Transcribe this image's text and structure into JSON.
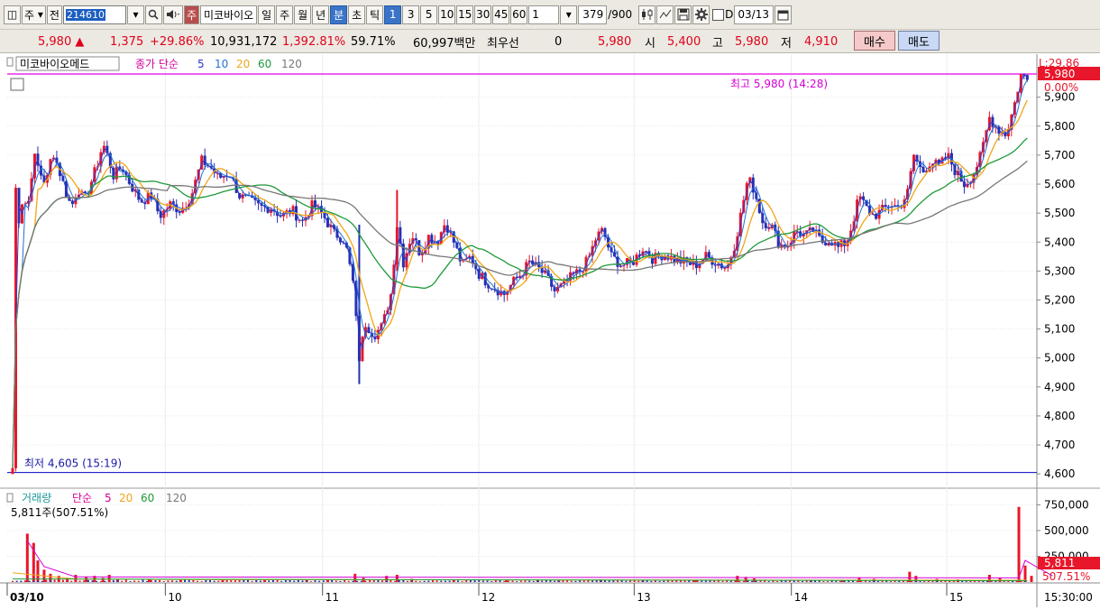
{
  "toolbar": {
    "grid_glyph": "◫",
    "period_label": "주",
    "prev_label": "전",
    "stock_code": "214610",
    "stock_type": "주",
    "stock_name": "미코바이오",
    "period_tabs": [
      "일",
      "주",
      "월",
      "년",
      "분",
      "초",
      "틱"
    ],
    "interval_tabs": [
      "1",
      "3",
      "5",
      "10",
      "15",
      "30",
      "45",
      "60"
    ],
    "interval_value": "1",
    "count_value": "379",
    "count_total": "/900",
    "checkbox_label": "D",
    "date_value": "03/13",
    "icons": [
      "search-icon",
      "speaker-icon",
      "candle-icon",
      "line-icon",
      "save-icon",
      "gear-icon",
      "calendar-icon"
    ]
  },
  "quote": {
    "price": "5,980",
    "arrow": "▲",
    "change": "1,375",
    "change_pct": "+29.86%",
    "volume": "10,931,172",
    "volume_pct": "1,392.81%",
    "rate": "59.71%",
    "amount": "60,997백만",
    "priority_label": "최우선",
    "priority_value": "0",
    "priority_price": "5,980",
    "open_label": "시",
    "open": "5,400",
    "high_label": "고",
    "high": "5,980",
    "low_label": "저",
    "low": "4,910",
    "buy_label": "매수",
    "sell_label": "매도"
  },
  "price_panel": {
    "stock_label": "미코바이오메드",
    "ma_label": "종가 단순",
    "ma_periods": [
      "5",
      "10",
      "20",
      "60",
      "120"
    ],
    "ma_colors": [
      "#3036c8",
      "#1e72d2",
      "#f0a616",
      "#1f9a3a",
      "#777777"
    ],
    "high_note": "최고 5,980 (14:28)",
    "low_note": "최저 4,605 (15:19)",
    "right_top_label": "L:29.86",
    "price_tag": "5,980",
    "pct_tag": "0.00%"
  },
  "volume_panel": {
    "label": "거래량",
    "ma_label": "단순",
    "ma_periods": [
      "5",
      "20",
      "60",
      "120"
    ],
    "current": "5,811주(507.51%)",
    "tag_value": "5,811",
    "tag_pct": "507.51%"
  },
  "x_axis": {
    "labels": [
      "03/10",
      "10",
      "11",
      "12",
      "13",
      "14",
      "15"
    ],
    "time_label": "15:30:00"
  },
  "chart_data": {
    "type": "candlestick",
    "y_ticks": [
      5900,
      5800,
      5700,
      5600,
      5500,
      5400,
      5300,
      5200,
      5100,
      5000,
      4900,
      4800,
      4700,
      4600
    ],
    "y_tick_labels": [
      "5,900",
      "5,800",
      "5,700",
      "5,600",
      "5,500",
      "5,400",
      "5,300",
      "5,200",
      "5,100",
      "5,000",
      "4,900",
      "4,800",
      "4,700",
      "4,600"
    ],
    "ylim": [
      4560,
      5980
    ],
    "high_line": 5980,
    "low_line": 4605,
    "volume_ticks": [
      750000,
      500000,
      250000
    ],
    "volume_tick_labels": [
      "750,000",
      "500,000",
      "250,000"
    ],
    "volume_ylim": [
      0,
      850000
    ],
    "close_path": [
      [
        0,
        4620
      ],
      [
        2,
        5620
      ],
      [
        6,
        5480
      ],
      [
        10,
        5560
      ],
      [
        14,
        5510
      ],
      [
        20,
        5700
      ],
      [
        26,
        5640
      ],
      [
        32,
        5600
      ],
      [
        38,
        5720
      ],
      [
        44,
        5650
      ],
      [
        50,
        5580
      ],
      [
        56,
        5520
      ],
      [
        62,
        5590
      ],
      [
        68,
        5540
      ],
      [
        74,
        5600
      ],
      [
        80,
        5660
      ],
      [
        86,
        5740
      ],
      [
        90,
        5700
      ],
      [
        96,
        5630
      ],
      [
        104,
        5660
      ],
      [
        112,
        5600
      ],
      [
        122,
        5540
      ],
      [
        132,
        5560
      ],
      [
        140,
        5490
      ],
      [
        150,
        5530
      ],
      [
        160,
        5510
      ],
      [
        170,
        5560
      ],
      [
        180,
        5680
      ],
      [
        188,
        5660
      ],
      [
        196,
        5620
      ],
      [
        206,
        5640
      ],
      [
        216,
        5560
      ],
      [
        226,
        5540
      ],
      [
        236,
        5520
      ],
      [
        246,
        5520
      ],
      [
        256,
        5490
      ],
      [
        266,
        5510
      ],
      [
        276,
        5470
      ],
      [
        286,
        5530
      ],
      [
        296,
        5490
      ],
      [
        306,
        5430
      ],
      [
        316,
        5410
      ],
      [
        324,
        5260
      ],
      [
        330,
        5000
      ],
      [
        336,
        5120
      ],
      [
        344,
        5080
      ],
      [
        352,
        5110
      ],
      [
        360,
        5220
      ],
      [
        366,
        5460
      ],
      [
        372,
        5330
      ],
      [
        380,
        5430
      ],
      [
        388,
        5360
      ],
      [
        396,
        5420
      ],
      [
        404,
        5400
      ],
      [
        412,
        5470
      ],
      [
        420,
        5400
      ],
      [
        428,
        5320
      ],
      [
        436,
        5350
      ],
      [
        444,
        5290
      ],
      [
        452,
        5260
      ],
      [
        460,
        5240
      ],
      [
        468,
        5220
      ],
      [
        476,
        5260
      ],
      [
        484,
        5290
      ],
      [
        492,
        5330
      ],
      [
        500,
        5310
      ],
      [
        508,
        5280
      ],
      [
        516,
        5230
      ],
      [
        524,
        5250
      ],
      [
        532,
        5280
      ],
      [
        540,
        5300
      ],
      [
        548,
        5340
      ],
      [
        556,
        5420
      ],
      [
        562,
        5440
      ],
      [
        570,
        5350
      ],
      [
        580,
        5320
      ],
      [
        590,
        5330
      ],
      [
        600,
        5380
      ],
      [
        610,
        5340
      ],
      [
        620,
        5360
      ],
      [
        630,
        5340
      ],
      [
        640,
        5330
      ],
      [
        650,
        5320
      ],
      [
        660,
        5350
      ],
      [
        670,
        5330
      ],
      [
        680,
        5310
      ],
      [
        688,
        5400
      ],
      [
        694,
        5510
      ],
      [
        700,
        5620
      ],
      [
        706,
        5580
      ],
      [
        714,
        5470
      ],
      [
        722,
        5460
      ],
      [
        730,
        5390
      ],
      [
        738,
        5390
      ],
      [
        746,
        5440
      ],
      [
        754,
        5420
      ],
      [
        762,
        5440
      ],
      [
        770,
        5400
      ],
      [
        778,
        5410
      ],
      [
        786,
        5380
      ],
      [
        794,
        5400
      ],
      [
        800,
        5470
      ],
      [
        806,
        5560
      ],
      [
        812,
        5520
      ],
      [
        820,
        5490
      ],
      [
        828,
        5510
      ],
      [
        836,
        5530
      ],
      [
        844,
        5520
      ],
      [
        852,
        5570
      ],
      [
        858,
        5700
      ],
      [
        866,
        5640
      ],
      [
        874,
        5680
      ],
      [
        882,
        5660
      ],
      [
        890,
        5700
      ],
      [
        898,
        5640
      ],
      [
        906,
        5600
      ],
      [
        914,
        5630
      ],
      [
        922,
        5700
      ],
      [
        930,
        5830
      ],
      [
        938,
        5790
      ],
      [
        946,
        5770
      ],
      [
        954,
        5880
      ],
      [
        960,
        5980
      ],
      [
        966,
        5960
      ]
    ],
    "volume_bars": [
      [
        14,
        470000
      ],
      [
        20,
        380000
      ],
      [
        24,
        210000
      ],
      [
        30,
        120000
      ],
      [
        36,
        80000
      ],
      [
        44,
        60000
      ],
      [
        52,
        40000
      ],
      [
        60,
        70000
      ],
      [
        70,
        50000
      ],
      [
        78,
        60000
      ],
      [
        86,
        40000
      ],
      [
        92,
        70000
      ],
      [
        100,
        30000
      ],
      [
        130,
        25000
      ],
      [
        160,
        20000
      ],
      [
        200,
        22000
      ],
      [
        240,
        18000
      ],
      [
        280,
        20000
      ],
      [
        300,
        25000
      ],
      [
        326,
        80000
      ],
      [
        334,
        40000
      ],
      [
        356,
        60000
      ],
      [
        366,
        70000
      ],
      [
        380,
        30000
      ],
      [
        420,
        20000
      ],
      [
        470,
        18000
      ],
      [
        500,
        20000
      ],
      [
        520,
        15000
      ],
      [
        560,
        25000
      ],
      [
        600,
        20000
      ],
      [
        650,
        15000
      ],
      [
        690,
        60000
      ],
      [
        698,
        50000
      ],
      [
        706,
        35000
      ],
      [
        760,
        20000
      ],
      [
        790,
        22000
      ],
      [
        806,
        45000
      ],
      [
        820,
        30000
      ],
      [
        854,
        100000
      ],
      [
        860,
        60000
      ],
      [
        880,
        30000
      ],
      [
        900,
        25000
      ],
      [
        930,
        70000
      ],
      [
        940,
        40000
      ],
      [
        958,
        730000
      ],
      [
        964,
        160000
      ],
      [
        970,
        60000
      ]
    ]
  }
}
